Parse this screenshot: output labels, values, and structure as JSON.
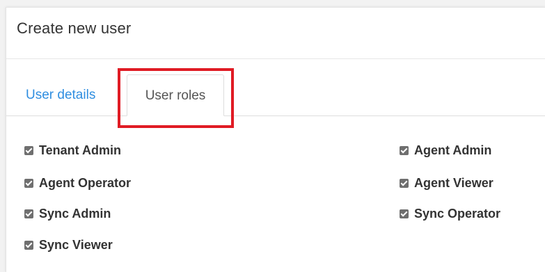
{
  "dialog": {
    "title": "Create new user"
  },
  "tabs": {
    "details_label": "User details",
    "roles_label": "User roles",
    "active": "User roles"
  },
  "roles": [
    {
      "label": "Tenant Admin",
      "checked": true
    },
    {
      "label": "Agent Admin",
      "checked": true
    },
    {
      "label": "Agent Operator",
      "checked": true
    },
    {
      "label": "Agent Viewer",
      "checked": true
    },
    {
      "label": "Sync Admin",
      "checked": true
    },
    {
      "label": "Sync Operator",
      "checked": true
    },
    {
      "label": "Sync Viewer",
      "checked": true
    }
  ],
  "colors": {
    "link_blue": "#2f8ee0",
    "highlight_red": "#e01b24",
    "checkbox_gray": "#6f6f6f"
  }
}
